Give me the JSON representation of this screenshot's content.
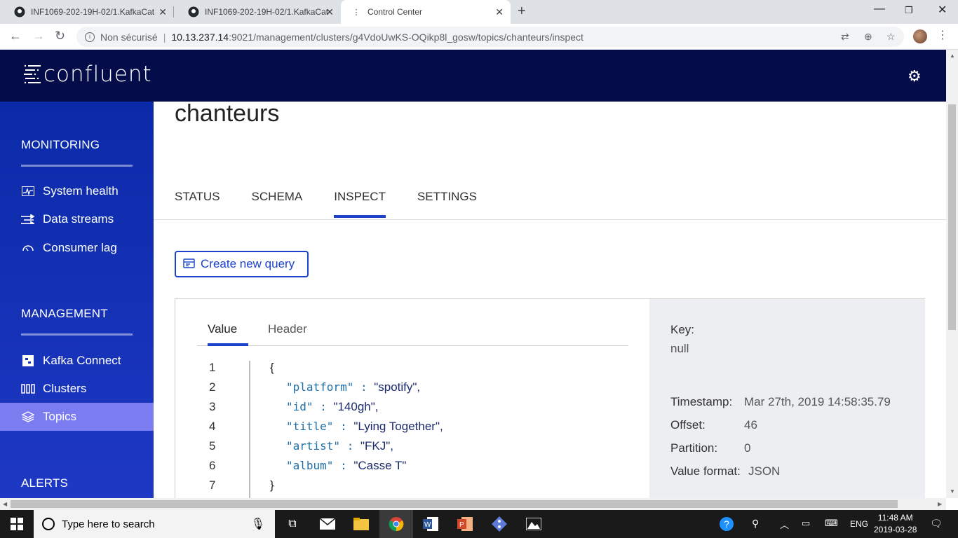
{
  "browser": {
    "tabs": [
      {
        "title": "INF1069-202-19H-02/1.KafkaCat"
      },
      {
        "title": "INF1069-202-19H-02/1.KafkaCat"
      },
      {
        "title": "Control Center"
      }
    ],
    "security_label": "Non sécurisé",
    "url_host": "10.13.237.14",
    "url_path": ":9021/management/clusters/g4VdoUwKS-OQikp8l_gosw/topics/chanteurs/inspect"
  },
  "app": {
    "logo_text": "confluent"
  },
  "sidebar": {
    "monitoring_title": "MONITORING",
    "monitoring_items": [
      {
        "label": "System health",
        "icon": "pulse-icon"
      },
      {
        "label": "Data streams",
        "icon": "streams-icon"
      },
      {
        "label": "Consumer lag",
        "icon": "gauge-icon"
      }
    ],
    "management_title": "MANAGEMENT",
    "management_items": [
      {
        "label": "Kafka Connect",
        "icon": "connect-icon"
      },
      {
        "label": "Clusters",
        "icon": "clusters-icon"
      },
      {
        "label": "Topics",
        "icon": "layers-icon",
        "active": true
      }
    ],
    "alerts_title": "ALERTS"
  },
  "main": {
    "title": "chanteurs",
    "tabs": [
      {
        "label": "STATUS"
      },
      {
        "label": "SCHEMA"
      },
      {
        "label": "INSPECT",
        "active": true
      },
      {
        "label": "SETTINGS"
      }
    ],
    "create_query_label": "Create new query",
    "message": {
      "tabs": [
        {
          "label": "Value",
          "active": true
        },
        {
          "label": "Header"
        }
      ],
      "lines": [
        {
          "n": "1",
          "open": "{"
        },
        {
          "n": "2",
          "key": "\"platform\"",
          "val": "\"spotify\","
        },
        {
          "n": "3",
          "key": "\"id\"",
          "val": "\"140gh\","
        },
        {
          "n": "4",
          "key": "\"title\"",
          "val": "\"Lying Together\","
        },
        {
          "n": "5",
          "key": "\"artist\"",
          "val": "\"FKJ\","
        },
        {
          "n": "6",
          "key": "\"album\"",
          "val": "\"Casse T\""
        },
        {
          "n": "7",
          "close": "}"
        }
      ],
      "key_label": "Key:",
      "key_value": "null",
      "timestamp_label": "Timestamp:",
      "timestamp_value": "Mar 27th, 2019 14:58:35.79",
      "offset_label": "Offset:",
      "offset_value": "46",
      "partition_label": "Partition:",
      "partition_value": "0",
      "format_label": "Value format:",
      "format_value": "JSON"
    }
  },
  "taskbar": {
    "search_placeholder": "Type here to search",
    "lang": "ENG",
    "time": "11:48 AM",
    "date": "2019-03-28"
  }
}
